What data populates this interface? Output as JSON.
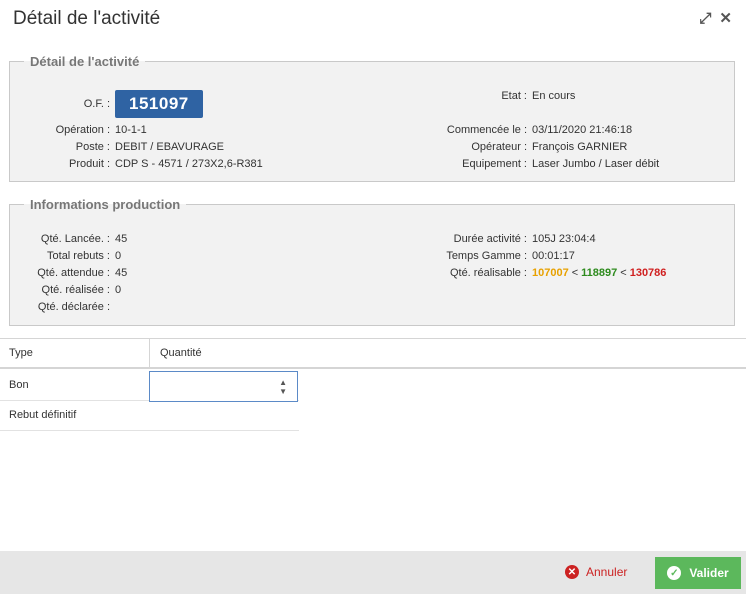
{
  "dialog": {
    "title": "Détail de l'activité"
  },
  "icons": {
    "expand": "expand-icon",
    "close": "close-icon",
    "cancel": "x-circle-icon",
    "ok": "check-circle-icon"
  },
  "detail": {
    "legend": "Détail de l'activité",
    "of_label": "O.F. :",
    "of_value": "151097",
    "operation_label": "Opération :",
    "operation_value": "10-1-1",
    "poste_label": "Poste :",
    "poste_value": "DEBIT / EBAVURAGE",
    "produit_label": "Produit :",
    "produit_value": "CDP S - 4571 / 273X2,6-R381",
    "etat_label": "Etat :",
    "etat_value": "En cours",
    "commencee_label": "Commencée le :",
    "commencee_value": "03/11/2020 21:46:18",
    "operateur_label": "Opérateur :",
    "operateur_value": "François GARNIER",
    "equipement_label": "Equipement :",
    "equipement_value": "Laser Jumbo / Laser débit"
  },
  "production": {
    "legend": "Informations production",
    "qte_lancee_label": "Qté. Lancée. :",
    "qte_lancee_value": "45",
    "total_rebuts_label": "Total rebuts :",
    "total_rebuts_value": "0",
    "qte_attendue_label": "Qté. attendue :",
    "qte_attendue_value": "45",
    "qte_realisee_label": "Qté. réalisée :",
    "qte_realisee_value": "0",
    "qte_declaree_label": "Qté. déclarée :",
    "duree_label": "Durée activité :",
    "duree_value": "105J 23:04:4",
    "temps_label": "Temps Gamme :",
    "temps_value": "00:01:17",
    "realisable_label": "Qté. réalisable :",
    "realisable_v1": "107007",
    "realisable_sep1": "<",
    "realisable_v2": "118897",
    "realisable_sep2": "<",
    "realisable_v3": "130786"
  },
  "table": {
    "col_type": "Type",
    "col_qty": "Quantité",
    "rows": [
      {
        "type": "Bon",
        "qty": ""
      },
      {
        "type": "Rebut définitif"
      }
    ]
  },
  "footer": {
    "cancel_label": "Annuler",
    "ok_label": "Valider"
  },
  "colors": {
    "accent": "#2f63a3",
    "ok": "#5cb85c",
    "cancel": "#cc2222",
    "orange": "#e8a100",
    "green": "#2e8b1e",
    "red": "#d02020"
  }
}
